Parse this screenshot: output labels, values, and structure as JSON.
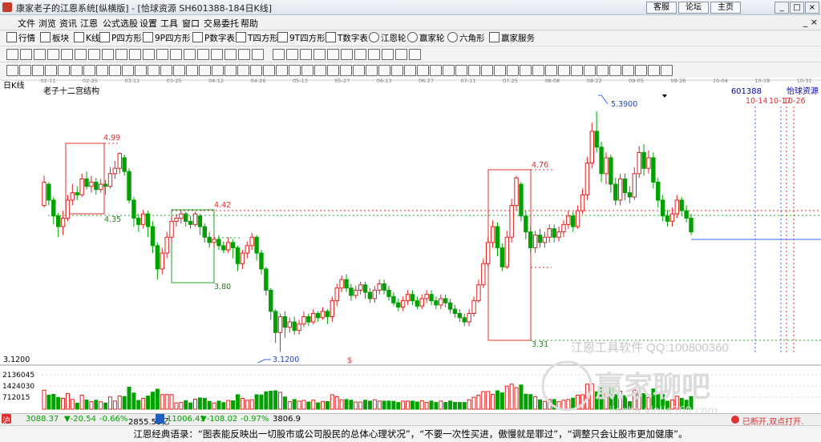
{
  "window": {
    "title": "康家老子的江恩系统[纵横版] - [恰球资源  SH601388-184日K线]",
    "links": [
      "客服",
      "论坛",
      "主页"
    ],
    "controls": [
      "_",
      "□",
      "×"
    ]
  },
  "menubar": {
    "items": [
      "文件",
      "浏览",
      "资讯",
      "江恩",
      "公式选股",
      "设置",
      "工具",
      "窗口",
      "交易委托",
      "帮助"
    ],
    "close": "_ ×"
  },
  "toolbar1": {
    "items": [
      "行情",
      "板块",
      "K线",
      "P四方形",
      "9P四方形",
      "P数字表",
      "T四方形",
      "9T四方形",
      "T数字表",
      "江恩轮",
      "赢家轮",
      "六角形",
      "赢家服务"
    ]
  },
  "chart": {
    "tab_label": "日K线",
    "study_title": "老子十二宫结构",
    "stock_code": "601388",
    "stock_name": "怡球资源",
    "date_ticks": [
      "02-11",
      "02-25",
      "03-11",
      "03-25",
      "04-12",
      "04-26",
      "05-13",
      "05-27",
      "06-13",
      "06-27",
      "07-11",
      "07-25",
      "08-08",
      "08-22",
      "09-05",
      "09-26",
      "10-04",
      "10-18",
      "10-31"
    ],
    "future_dates": [
      "10-14",
      "10-17",
      "10-26"
    ],
    "price_labels": {
      "p499": "4.99",
      "p435": "4.35",
      "p442": "4.42",
      "p380": "3.80",
      "p476": "4.76",
      "p331": "3.31",
      "p539": "5.3900",
      "p312": "3.1200",
      "axis_low": "3.1200"
    },
    "dollar_mark": "$",
    "volume_ticks": [
      "2136045",
      "1424030",
      "712015"
    ],
    "watermark_soft": "江恩工具软件  QQ:100800360",
    "watermark_brand": "赢家聊吧",
    "watermark_url": "jiaoba.yinjia360.com",
    "colors": {
      "up": "#e02020",
      "down": "#00a000",
      "box_red": "#e03030",
      "box_green": "#20a020",
      "dash_blue": "#4060ff"
    }
  },
  "chart_data": {
    "type": "candlestick",
    "title": "",
    "ylabel": "",
    "ylim": [
      3.0,
      5.6
    ],
    "candles": [
      [
        4.5,
        4.72,
        4.78,
        4.48
      ],
      [
        4.7,
        4.55,
        4.72,
        4.5
      ],
      [
        4.55,
        4.4,
        4.58,
        4.32
      ],
      [
        4.4,
        4.3,
        4.43,
        4.2
      ],
      [
        4.3,
        4.38,
        4.45,
        4.22
      ],
      [
        4.38,
        4.55,
        4.6,
        4.35
      ],
      [
        4.55,
        4.62,
        4.7,
        4.5
      ],
      [
        4.62,
        4.6,
        4.68,
        4.55
      ],
      [
        4.6,
        4.75,
        4.8,
        4.58
      ],
      [
        4.75,
        4.68,
        4.82,
        4.65
      ],
      [
        4.68,
        4.72,
        4.78,
        4.62
      ],
      [
        4.72,
        4.65,
        4.76,
        4.6
      ],
      [
        4.65,
        4.7,
        4.75,
        4.62
      ],
      [
        4.7,
        4.68,
        4.74,
        4.6
      ],
      [
        4.68,
        4.8,
        4.86,
        4.66
      ],
      [
        4.8,
        4.85,
        4.92,
        4.75
      ],
      [
        4.85,
        4.99,
        5.0,
        4.8
      ],
      [
        4.95,
        4.82,
        4.98,
        4.78
      ],
      [
        4.82,
        4.55,
        4.85,
        4.52
      ],
      [
        4.55,
        4.38,
        4.58,
        4.3
      ],
      [
        4.38,
        4.32,
        4.42,
        4.25
      ],
      [
        4.32,
        4.42,
        4.46,
        4.28
      ],
      [
        4.42,
        4.3,
        4.45,
        4.2
      ],
      [
        4.3,
        4.12,
        4.35,
        4.05
      ],
      [
        4.12,
        3.9,
        4.15,
        3.8
      ],
      [
        3.9,
        4.05,
        4.1,
        3.85
      ],
      [
        4.05,
        4.2,
        4.25,
        4.0
      ],
      [
        4.2,
        4.35,
        4.4,
        4.15
      ],
      [
        4.35,
        4.38,
        4.42,
        4.3
      ],
      [
        4.38,
        4.42,
        4.45,
        4.33
      ],
      [
        4.42,
        4.35,
        4.44,
        4.3
      ],
      [
        4.35,
        4.32,
        4.4,
        4.28
      ],
      [
        4.32,
        4.42,
        4.44,
        4.3
      ],
      [
        4.4,
        4.3,
        4.42,
        4.22
      ],
      [
        4.3,
        4.2,
        4.33,
        4.15
      ],
      [
        4.2,
        4.15,
        4.25,
        4.1
      ],
      [
        4.15,
        4.18,
        4.22,
        4.1
      ],
      [
        4.18,
        4.12,
        4.22,
        4.08
      ],
      [
        4.12,
        4.08,
        4.16,
        4.05
      ],
      [
        4.08,
        4.15,
        4.2,
        4.05
      ],
      [
        4.15,
        4.1,
        4.18,
        4.0
      ],
      [
        4.1,
        3.95,
        4.12,
        3.88
      ],
      [
        3.95,
        4.05,
        4.08,
        3.9
      ],
      [
        4.05,
        4.12,
        4.16,
        4.0
      ],
      [
        4.12,
        4.2,
        4.24,
        4.08
      ],
      [
        4.2,
        4.05,
        4.22,
        3.98
      ],
      [
        4.05,
        3.9,
        4.08,
        3.85
      ],
      [
        3.9,
        3.7,
        3.92,
        3.65
      ],
      [
        3.7,
        3.5,
        3.72,
        3.42
      ],
      [
        3.5,
        3.3,
        3.52,
        3.2
      ],
      [
        3.3,
        3.45,
        3.48,
        3.12
      ],
      [
        3.45,
        3.35,
        3.5,
        3.25
      ],
      [
        3.35,
        3.4,
        3.44,
        3.3
      ],
      [
        3.4,
        3.32,
        3.45,
        3.28
      ],
      [
        3.32,
        3.38,
        3.42,
        3.28
      ],
      [
        3.38,
        3.45,
        3.5,
        3.35
      ],
      [
        3.45,
        3.4,
        3.48,
        3.36
      ],
      [
        3.4,
        3.48,
        3.52,
        3.38
      ],
      [
        3.48,
        3.44,
        3.5,
        3.4
      ],
      [
        3.44,
        3.5,
        3.54,
        3.42
      ],
      [
        3.5,
        3.45,
        3.52,
        3.38
      ],
      [
        3.45,
        3.6,
        3.64,
        3.4
      ],
      [
        3.6,
        3.72,
        3.76,
        3.55
      ],
      [
        3.72,
        3.8,
        3.84,
        3.68
      ],
      [
        3.8,
        3.72,
        3.85,
        3.68
      ],
      [
        3.72,
        3.65,
        3.76,
        3.6
      ],
      [
        3.65,
        3.7,
        3.74,
        3.62
      ],
      [
        3.7,
        3.75,
        3.78,
        3.66
      ],
      [
        3.75,
        3.68,
        3.78,
        3.62
      ],
      [
        3.68,
        3.62,
        3.72,
        3.58
      ],
      [
        3.62,
        3.7,
        3.74,
        3.58
      ],
      [
        3.7,
        3.76,
        3.8,
        3.66
      ],
      [
        3.76,
        3.7,
        3.8,
        3.66
      ],
      [
        3.7,
        3.64,
        3.74,
        3.6
      ],
      [
        3.64,
        3.58,
        3.68,
        3.55
      ],
      [
        3.58,
        3.54,
        3.62,
        3.5
      ],
      [
        3.54,
        3.6,
        3.64,
        3.5
      ],
      [
        3.6,
        3.66,
        3.7,
        3.56
      ],
      [
        3.66,
        3.6,
        3.7,
        3.56
      ],
      [
        3.6,
        3.55,
        3.64,
        3.52
      ],
      [
        3.55,
        3.62,
        3.66,
        3.52
      ],
      [
        3.62,
        3.66,
        3.7,
        3.58
      ],
      [
        3.66,
        3.6,
        3.7,
        3.56
      ],
      [
        3.6,
        3.56,
        3.64,
        3.52
      ],
      [
        3.56,
        3.62,
        3.66,
        3.52
      ],
      [
        3.62,
        3.58,
        3.66,
        3.54
      ],
      [
        3.58,
        3.52,
        3.62,
        3.48
      ],
      [
        3.52,
        3.48,
        3.56,
        3.44
      ],
      [
        3.48,
        3.44,
        3.52,
        3.4
      ],
      [
        3.44,
        3.4,
        3.48,
        3.36
      ],
      [
        3.4,
        3.48,
        3.52,
        3.36
      ],
      [
        3.48,
        3.6,
        3.64,
        3.45
      ],
      [
        3.6,
        3.75,
        3.8,
        3.58
      ],
      [
        3.75,
        3.95,
        4.0,
        3.72
      ],
      [
        3.95,
        4.15,
        4.2,
        3.92
      ],
      [
        4.15,
        4.3,
        4.36,
        4.1
      ],
      [
        4.3,
        4.1,
        4.34,
        4.02
      ],
      [
        4.1,
        3.92,
        4.14,
        3.88
      ],
      [
        3.92,
        4.2,
        4.26,
        3.9
      ],
      [
        4.2,
        4.5,
        4.56,
        4.15
      ],
      [
        4.5,
        4.76,
        4.78,
        4.45
      ],
      [
        4.7,
        4.4,
        4.72,
        4.35
      ],
      [
        4.4,
        4.25,
        4.45,
        4.18
      ],
      [
        4.25,
        4.1,
        4.3,
        4.05
      ],
      [
        4.1,
        4.22,
        4.26,
        4.05
      ],
      [
        4.22,
        4.15,
        4.28,
        4.1
      ],
      [
        4.15,
        4.2,
        4.25,
        4.1
      ],
      [
        4.2,
        4.28,
        4.32,
        4.15
      ],
      [
        4.28,
        4.2,
        4.32,
        4.15
      ],
      [
        4.2,
        4.25,
        4.3,
        4.16
      ],
      [
        4.25,
        4.32,
        4.36,
        4.2
      ],
      [
        4.32,
        4.4,
        4.45,
        4.28
      ],
      [
        4.4,
        4.3,
        4.44,
        4.25
      ],
      [
        4.3,
        4.45,
        4.5,
        4.28
      ],
      [
        4.45,
        4.6,
        4.66,
        4.42
      ],
      [
        4.6,
        4.9,
        4.96,
        4.55
      ],
      [
        4.9,
        5.2,
        5.28,
        4.85
      ],
      [
        5.2,
        5.05,
        5.39,
        5.0
      ],
      [
        5.05,
        4.8,
        5.1,
        4.72
      ],
      [
        4.8,
        4.95,
        5.0,
        4.7
      ],
      [
        4.95,
        4.7,
        4.98,
        4.62
      ],
      [
        4.7,
        4.55,
        4.76,
        4.5
      ],
      [
        4.55,
        4.75,
        4.8,
        4.5
      ],
      [
        4.75,
        4.62,
        4.8,
        4.55
      ],
      [
        4.62,
        4.58,
        4.68,
        4.52
      ],
      [
        4.58,
        4.8,
        4.86,
        4.55
      ],
      [
        4.8,
        5.0,
        5.06,
        4.76
      ],
      [
        5.0,
        4.85,
        5.08,
        4.78
      ],
      [
        4.85,
        4.95,
        5.02,
        4.8
      ],
      [
        4.95,
        4.72,
        5.0,
        4.66
      ],
      [
        4.72,
        4.55,
        4.76,
        4.48
      ],
      [
        4.55,
        4.4,
        4.6,
        4.35
      ],
      [
        4.4,
        4.35,
        4.46,
        4.3
      ],
      [
        4.35,
        4.42,
        4.48,
        4.3
      ],
      [
        4.42,
        4.55,
        4.6,
        4.38
      ],
      [
        4.55,
        4.45,
        4.58,
        4.4
      ],
      [
        4.45,
        4.38,
        4.5,
        4.34
      ],
      [
        4.38,
        4.25,
        4.42,
        4.22
      ]
    ]
  },
  "status": {
    "sh_index": "3088.37",
    "sh_change": "▼-20.54",
    "sh_pct": "-0.66%",
    "sh_vol": "2855.53亿",
    "sz_index": "11006.41",
    "sz_change": "▼-108.02",
    "sz_pct": "-0.97%",
    "sz_vol": "3806.9",
    "right_text": "已断开,双点打开."
  },
  "quote": "江恩经典语录：“图表能反映出一切股市或公司股民的总体心理状况”，“不要一次性买进，傲慢就是罪过”，“调整只会让股市更加健康”。"
}
